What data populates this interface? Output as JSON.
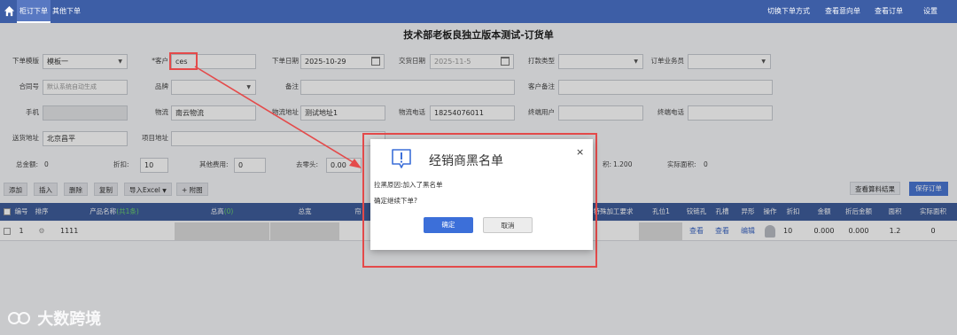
{
  "topbar": {
    "tabs": [
      {
        "label": "柜订下单"
      },
      {
        "label": "其他下单"
      }
    ],
    "right_links": [
      {
        "label": "切换下单方式"
      },
      {
        "label": "查看意向单"
      },
      {
        "label": "查看订单"
      },
      {
        "label": "设置"
      }
    ]
  },
  "page_title": "技术部老板良独立版本测试-订货单",
  "form": {
    "template_label": "下单模版",
    "template_value": "模板一",
    "customer_label": "*客户",
    "customer_value": "ces",
    "order_date_label": "下单日期",
    "order_date_value": "2025-10-29",
    "delivery_date_label": "交货日期",
    "delivery_date_value": "2025-11-5",
    "payment_type_label": "打款类型",
    "order_staff_label": "订单业务员",
    "contract_label": "合同号",
    "contract_placeholder": "默认系统自动生成",
    "brand_label": "品牌",
    "remark_label": "备注",
    "customer_remark_label": "客户备注",
    "phone_label": "手机",
    "logistics_label": "物流",
    "logistics_value": "南云物流",
    "logistics_addr_label": "物流地址",
    "logistics_addr_value": "测试地址1",
    "logistics_phone_label": "物流电话",
    "logistics_phone_value": "18254076011",
    "end_user_label": "终端用户",
    "end_phone_label": "终端电话",
    "delivery_addr_label": "送货地址",
    "delivery_addr_value": "北京昌平",
    "project_addr_label": "项目地址"
  },
  "summary": {
    "total_label": "总金额:",
    "total_value": "0",
    "discount_label": "折扣:",
    "discount_value": "10",
    "other_fee_label": "其他费用:",
    "other_fee_value": "0",
    "rounding_label": "去零头:",
    "rounding_value": "0.00",
    "area_label": "积:",
    "area_value": "1.200",
    "actual_area_label": "实际面积:",
    "actual_area_value": "0"
  },
  "toolbar": {
    "add": "添加",
    "insert": "插入",
    "delete": "删除",
    "copy": "复制",
    "import_excel": "导入Excel",
    "attach": "+ 附图",
    "view_calc": "查看算料结果",
    "save_order": "保存订单"
  },
  "table": {
    "headers": {
      "no": "编号",
      "sort": "排序",
      "product": "产品名称",
      "product_extra": "(共1条)",
      "total_height": "总高",
      "total_height_extra": "(0)",
      "total_width": "总宽",
      "more": "帘",
      "process": "特殊加工要求",
      "hole": "孔位1",
      "hinge": "铰链孔",
      "slot": "孔槽",
      "shape": "异形",
      "op": "操作",
      "disc": "折扣",
      "amount": "金额",
      "after_amount": "折后金额",
      "area": "面积",
      "actual_area": "实际面积"
    },
    "row": {
      "no": "1",
      "product": "1111",
      "view1": "查看",
      "view2": "查看",
      "edit": "编辑",
      "disc": "10",
      "amount": "0.000",
      "after_amount": "0.000",
      "area": "1.2",
      "actual_area": "0"
    }
  },
  "dialog": {
    "title": "经销商黑名单",
    "reason": "拉黑原因:加入了黑名单",
    "confirm_text": "确定继续下单?",
    "ok": "确定",
    "cancel": "取消",
    "close": "×"
  },
  "watermark": {
    "text": "大数跨境"
  },
  "colors": {
    "topbar": "#3d5ea6",
    "table_header": "#3f5d9c",
    "primary": "#3c6fd9",
    "annotation": "#e44a4a"
  }
}
